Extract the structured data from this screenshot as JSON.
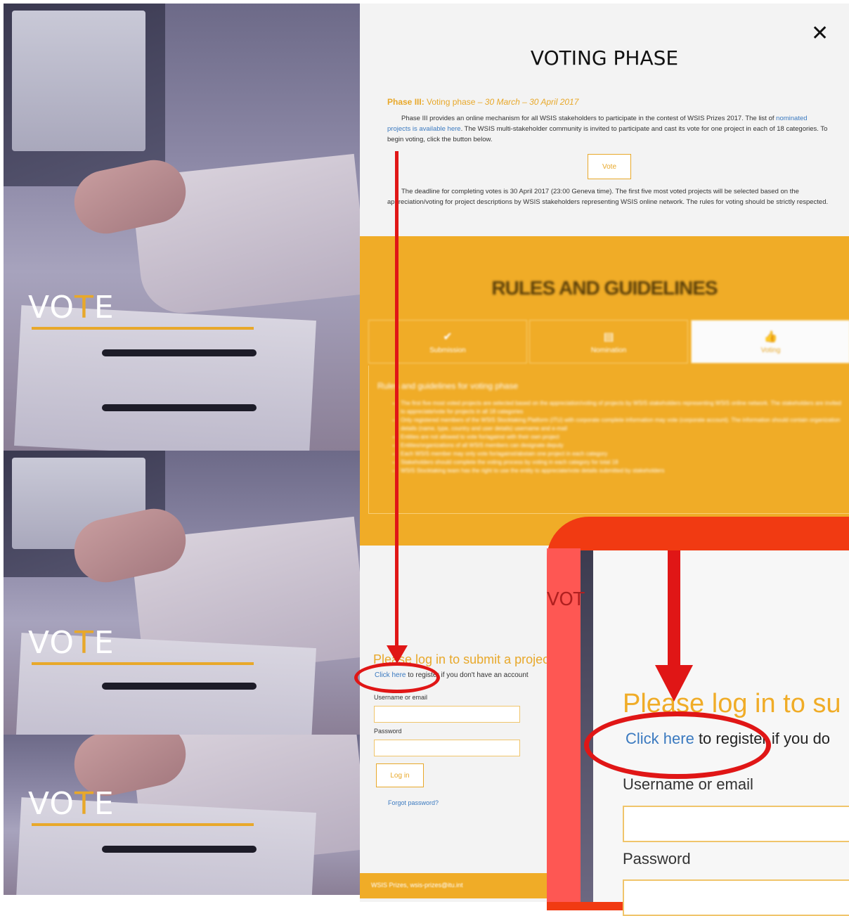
{
  "left_panel": {
    "banners": [
      {
        "v": "V",
        "o": "O",
        "t": "T",
        "e": "E"
      },
      {
        "v": "V",
        "o": "O",
        "t": "T",
        "e": "E"
      },
      {
        "v": "V",
        "o": "O",
        "t": "T",
        "e": "E"
      }
    ]
  },
  "modal": {
    "close_icon": "✕",
    "title": "VOTING PHASE",
    "phase_heading_bold": "Phase III:",
    "phase_heading_rest": " Voting phase – ",
    "phase_heading_dates": "30 March – 30 April 2017",
    "intro_part1": "Phase III provides an online mechanism for all WSIS stakeholders to participate in the contest of WSIS Prizes 2017. The list of ",
    "intro_link": "nominated projects is available here",
    "intro_part2": ". The WSIS multi-stakeholder community is invited to participate and cast its vote for one project in each of 18 categories. To begin voting, click the button below.",
    "vote_button": "Vote",
    "deadline_text": "The deadline for completing votes is 30 April 2017 (23:00 Geneva time). The first five most voted projects will be selected based on the appreciation/voting for project descriptions by WSIS stakeholders representing WSIS online network. The rules for voting should be strictly respected."
  },
  "rules": {
    "title": "RULES AND GUIDELINES",
    "tabs": [
      {
        "icon": "✔",
        "label": "Submission"
      },
      {
        "icon": "▤",
        "label": "Nomination"
      },
      {
        "icon": "👍",
        "label": "Voting"
      }
    ],
    "subtitle": "Rules and guidelines for voting phase",
    "items": [
      "The first five most voted projects are selected based on the appreciation/voting of projects by WSIS stakeholders representing WSIS online network. The stakeholders are invited to appreciate/vote for projects in all 18 categories",
      "Only registered members of the WSIS Stocktaking Platform (ITU) with corporate complete information may vote (corporate account). The information should contain organization details (name, type, country and user details) username and e-mail",
      "Entities are not allowed to vote for/against with their own project",
      "Entities/organizations of all WSIS members can designate deputy",
      "Each WSIS member may only vote for/against/abstain one project in each category",
      "Stakeholders should complete the voting process by voting in each category for total 18",
      "WSIS Stocktaking team has the right to use the entity to appreciate/vote details submitted by stakeholders"
    ]
  },
  "login": {
    "title": "Please log in to submit a project",
    "register_link": "Click here",
    "register_rest": " to register if you don't have an account",
    "username_label": "Username or email",
    "password_label": "Password",
    "login_button": "Log in",
    "forgot_link": "Forgot password?"
  },
  "footer": {
    "text": "WSIS Prizes, wsis-prizes@itu.int"
  },
  "zoom": {
    "vot_fragment": "VOT",
    "title_fragment": "Please log in to su",
    "register_link": "Click here",
    "register_rest_fragment": "to register if you do",
    "username_label": "Username or email",
    "password_label": "Password"
  },
  "colors": {
    "accent": "#e8a82a",
    "annotation": "#e01616",
    "link": "#3b7ac0"
  }
}
